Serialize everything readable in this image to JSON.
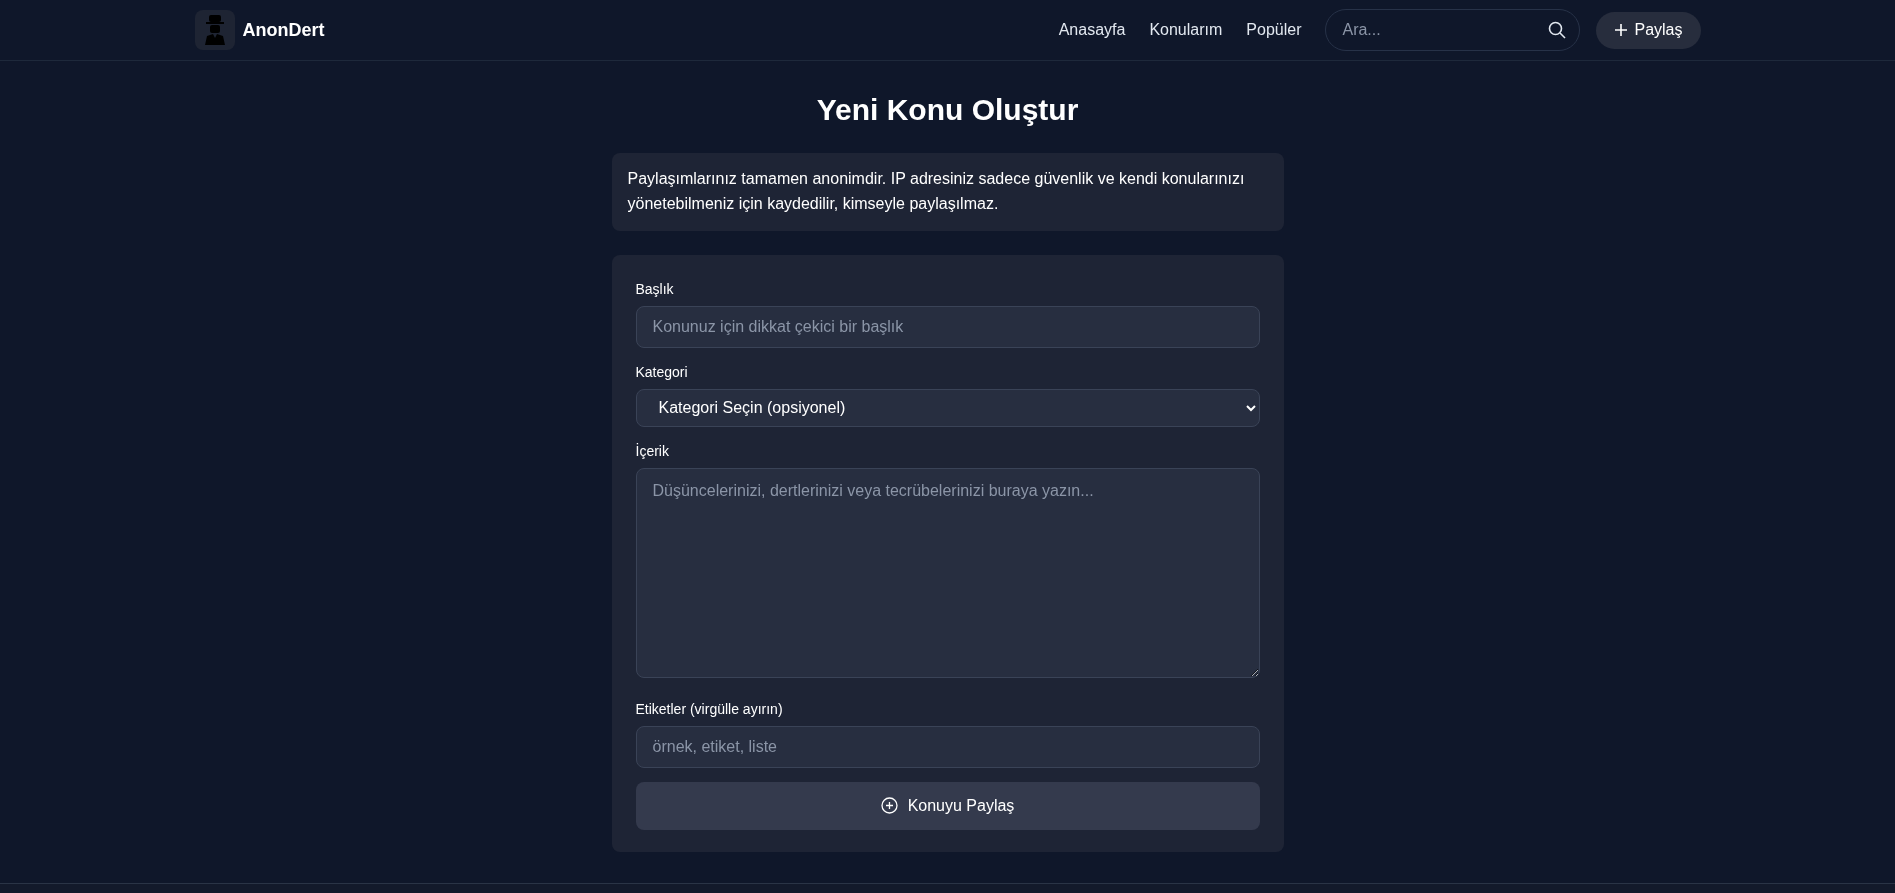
{
  "brand": {
    "name": "AnonDert"
  },
  "nav": [
    {
      "label": "Anasayfa"
    },
    {
      "label": "Konularım"
    },
    {
      "label": "Popüler"
    }
  ],
  "search": {
    "placeholder": "Ara..."
  },
  "share_button": {
    "label": "Paylaş"
  },
  "page_title": "Yeni Konu Oluştur",
  "notice": "Paylaşımlarınız tamamen anonimdir. IP adresiniz sadece güvenlik ve kendi konularınızı yönetebilmeniz için kaydedilir, kimseyle paylaşılmaz.",
  "form": {
    "fields": [
      {
        "kind": "input",
        "label": "Başlık",
        "placeholder": "Konunuz için dikkat çekici bir başlık"
      },
      {
        "kind": "select",
        "label": "Kategori",
        "value": "Kategori Seçin (opsiyonel)"
      },
      {
        "kind": "textarea",
        "label": "İçerik",
        "placeholder": "Düşüncelerinizi, dertlerinizi veya tecrübelerinizi buraya yazın..."
      },
      {
        "kind": "input",
        "label": "Etiketler (virgülle ayırın)",
        "placeholder": "örnek, etiket, liste"
      }
    ],
    "submit": {
      "label": "Konuyu Paylaş"
    }
  }
}
